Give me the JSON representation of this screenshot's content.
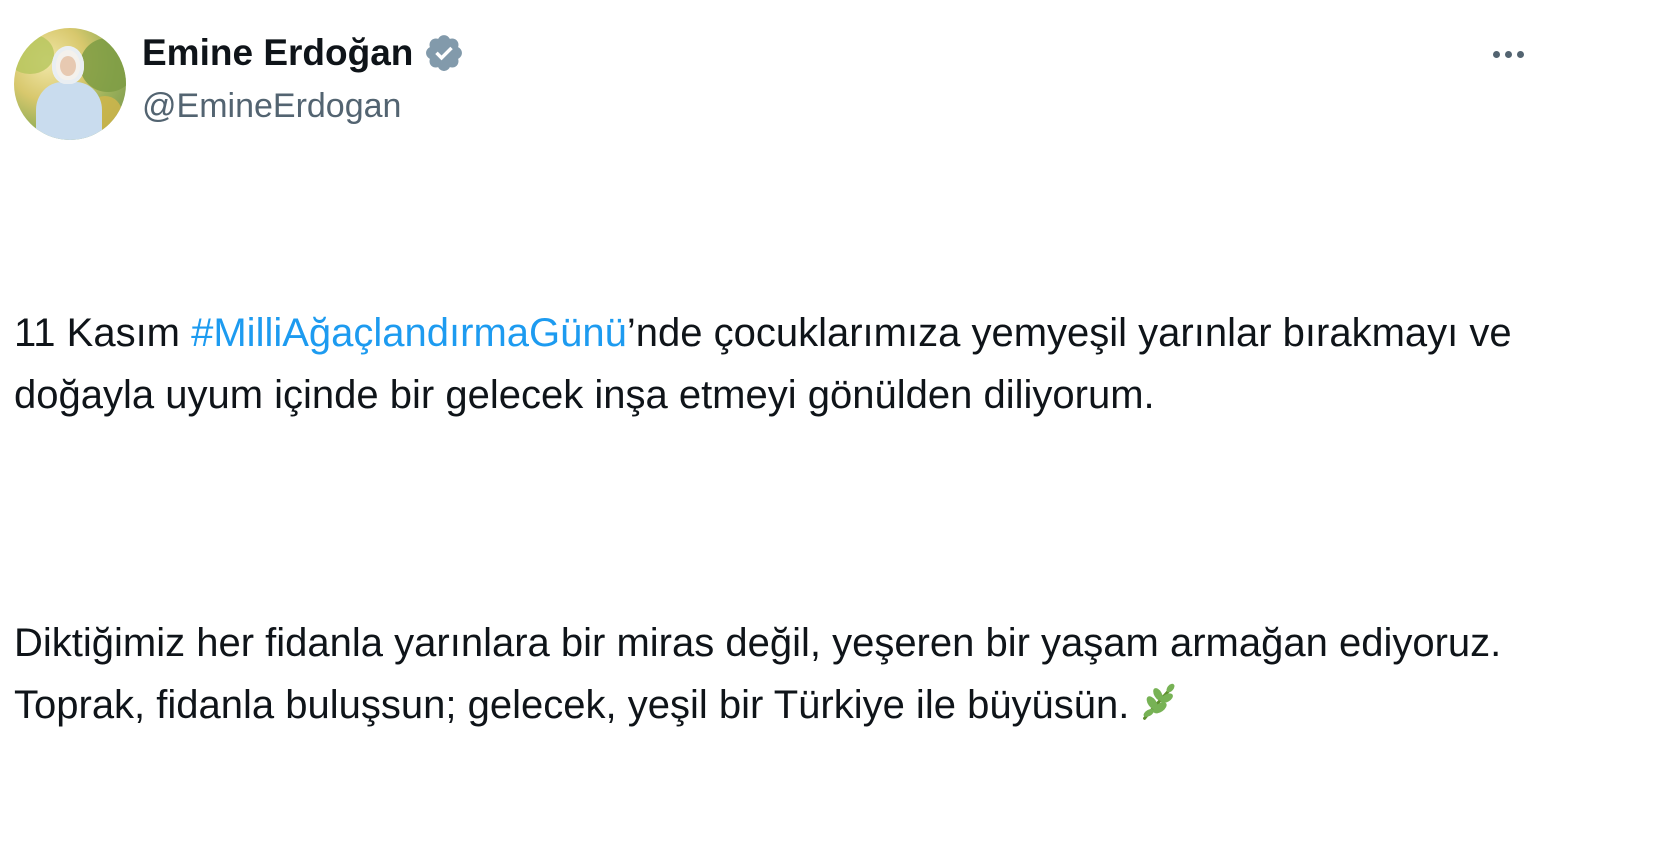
{
  "author": {
    "display_name": "Emine Erdoğan",
    "handle": "@EmineErdogan",
    "verified": true,
    "verified_icon": "verified-badge-icon",
    "verified_color": "#829aab"
  },
  "menu": {
    "icon": "more-options-icon"
  },
  "tweet": {
    "p1": {
      "before": "11 Kasım ",
      "hashtag": "#MilliAğaçlandırmaGünü",
      "after": "’nde çocuklarımıza yemyeşil yarınlar bırakmayı ve doğayla uyum içinde bir gelecek inşa etmeyi gönülden diliyorum."
    },
    "p2": {
      "text": "Diktiğimiz her fidanla yarınlara bir miras değil, yeşeren bir yaşam armağan ediyoruz. Toprak, fidanla buluşsun; gelecek, yeşil bir Türkiye ile büyüsün.",
      "emoji_icon": "herb-emoji-icon"
    }
  },
  "colors": {
    "text": "#0f1419",
    "secondary": "#536471",
    "link": "#1d9bf0"
  }
}
